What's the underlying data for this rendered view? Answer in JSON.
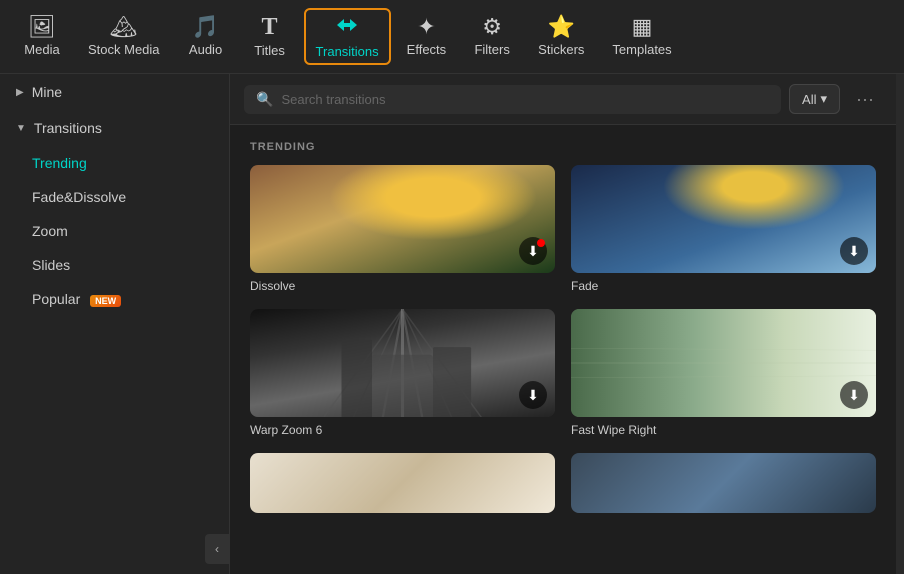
{
  "nav": {
    "items": [
      {
        "id": "media",
        "label": "Media",
        "icon": "🖼"
      },
      {
        "id": "stock-media",
        "label": "Stock Media",
        "icon": "🏔"
      },
      {
        "id": "audio",
        "label": "Audio",
        "icon": "🎵"
      },
      {
        "id": "titles",
        "label": "Titles",
        "icon": "T"
      },
      {
        "id": "transitions",
        "label": "Transitions",
        "icon": "⇄",
        "active": true
      },
      {
        "id": "effects",
        "label": "Effects",
        "icon": "✦"
      },
      {
        "id": "filters",
        "label": "Filters",
        "icon": "⚙"
      },
      {
        "id": "stickers",
        "label": "Stickers",
        "icon": "⭐"
      },
      {
        "id": "templates",
        "label": "Templates",
        "icon": "▦"
      }
    ]
  },
  "sidebar": {
    "mine_label": "Mine",
    "transitions_label": "Transitions",
    "sub_items": [
      {
        "id": "trending",
        "label": "Trending",
        "active": true
      },
      {
        "id": "fade-dissolve",
        "label": "Fade&Dissolve"
      },
      {
        "id": "zoom",
        "label": "Zoom"
      },
      {
        "id": "slides",
        "label": "Slides"
      },
      {
        "id": "popular",
        "label": "Popular",
        "badge": "NEW"
      }
    ],
    "collapse_icon": "<"
  },
  "search": {
    "placeholder": "Search transitions",
    "filter_label": "All",
    "more_icon": "···"
  },
  "content": {
    "section_label": "TRENDING",
    "items": [
      {
        "id": "dissolve",
        "label": "Dissolve",
        "type": "dissolve",
        "has_red_dot": true
      },
      {
        "id": "fade",
        "label": "Fade",
        "type": "fade",
        "has_red_dot": false
      },
      {
        "id": "warp-zoom-6",
        "label": "Warp Zoom 6",
        "type": "warp",
        "has_red_dot": false
      },
      {
        "id": "fast-wipe-right",
        "label": "Fast Wipe Right",
        "type": "fastwipe",
        "has_red_dot": false
      }
    ]
  }
}
